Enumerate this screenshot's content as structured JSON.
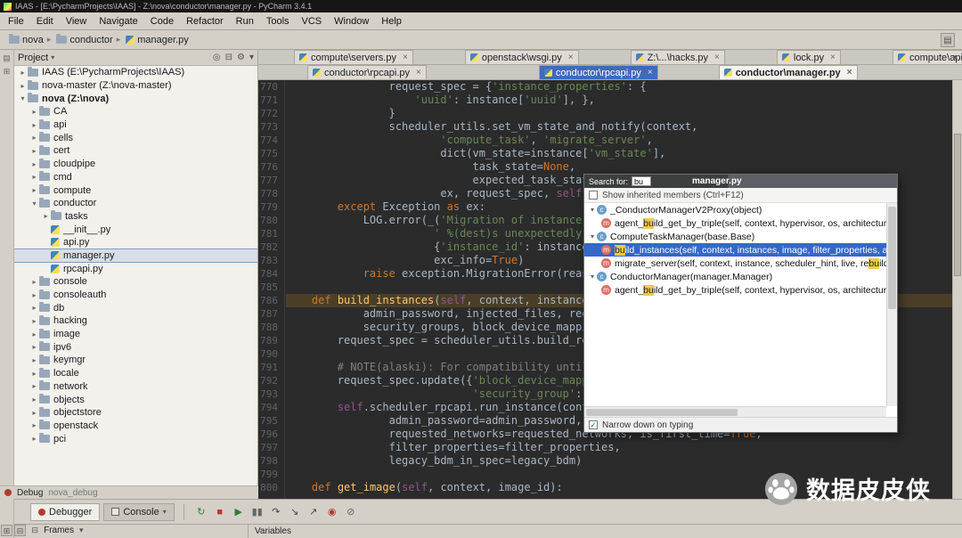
{
  "titlebar": {
    "title": "IAAS - [E:\\PycharmProjects\\IAAS] - Z:\\nova\\conductor\\manager.py - PyCharm 3.4.1"
  },
  "menubar": {
    "items": [
      "File",
      "Edit",
      "View",
      "Navigate",
      "Code",
      "Refactor",
      "Run",
      "Tools",
      "VCS",
      "Window",
      "Help"
    ]
  },
  "breadcrumb": {
    "items": [
      "nova",
      "conductor",
      "manager.py"
    ]
  },
  "icons": {
    "chevron_down": "▾",
    "close": "×",
    "gear": "⚙",
    "collapse_all": "⊟",
    "locate": "◎",
    "check": "✓",
    "grid": "▤",
    "square_plus": "⊞",
    "square_minus": "⊟"
  },
  "colors": {
    "editor_bg": "#2b2b2b",
    "keyword": "#cc7832",
    "string": "#6a8759",
    "comment": "#808080",
    "selection_blue": "#3c6cbb",
    "popup_selection": "#3468c9",
    "match_highlight": "#efc94c",
    "line_highlight": "#4a3f26"
  },
  "project_panel": {
    "title": "Project",
    "header_icons": [
      {
        "name": "locate-icon",
        "glyph": "◎"
      },
      {
        "name": "collapse-all-icon",
        "glyph": "⊟"
      },
      {
        "name": "settings-icon",
        "glyph": "⚙"
      },
      {
        "name": "hide-icon",
        "glyph": "▾"
      }
    ],
    "tree": [
      {
        "label": "IAAS (E:\\PycharmProjects\\IAAS)",
        "depth": 0,
        "kind": "folder",
        "arrow": "collapsed"
      },
      {
        "label": "nova-master (Z:\\nova-master)",
        "depth": 0,
        "kind": "folder",
        "arrow": "collapsed"
      },
      {
        "label": "nova (Z:\\nova)",
        "depth": 0,
        "kind": "folder",
        "arrow": "expanded",
        "bold": true
      },
      {
        "label": "CA",
        "depth": 1,
        "kind": "folder",
        "arrow": "collapsed"
      },
      {
        "label": "api",
        "depth": 1,
        "kind": "folder",
        "arrow": "collapsed"
      },
      {
        "label": "cells",
        "depth": 1,
        "kind": "folder",
        "arrow": "collapsed"
      },
      {
        "label": "cert",
        "depth": 1,
        "kind": "folder",
        "arrow": "collapsed"
      },
      {
        "label": "cloudpipe",
        "depth": 1,
        "kind": "folder",
        "arrow": "collapsed"
      },
      {
        "label": "cmd",
        "depth": 1,
        "kind": "folder",
        "arrow": "collapsed"
      },
      {
        "label": "compute",
        "depth": 1,
        "kind": "folder",
        "arrow": "collapsed"
      },
      {
        "label": "conductor",
        "depth": 1,
        "kind": "folder",
        "arrow": "expanded"
      },
      {
        "label": "tasks",
        "depth": 2,
        "kind": "folder",
        "arrow": "collapsed"
      },
      {
        "label": "__init__.py",
        "depth": 2,
        "kind": "pyfile"
      },
      {
        "label": "api.py",
        "depth": 2,
        "kind": "pyfile"
      },
      {
        "label": "manager.py",
        "depth": 2,
        "kind": "pyfile",
        "selected": true
      },
      {
        "label": "rpcapi.py",
        "depth": 2,
        "kind": "pyfile"
      },
      {
        "label": "console",
        "depth": 1,
        "kind": "folder",
        "arrow": "collapsed"
      },
      {
        "label": "consoleauth",
        "depth": 1,
        "kind": "folder",
        "arrow": "collapsed"
      },
      {
        "label": "db",
        "depth": 1,
        "kind": "folder",
        "arrow": "collapsed"
      },
      {
        "label": "hacking",
        "depth": 1,
        "kind": "folder",
        "arrow": "collapsed"
      },
      {
        "label": "image",
        "depth": 1,
        "kind": "folder",
        "arrow": "collapsed"
      },
      {
        "label": "ipv6",
        "depth": 1,
        "kind": "folder",
        "arrow": "collapsed"
      },
      {
        "label": "keymgr",
        "depth": 1,
        "kind": "folder",
        "arrow": "collapsed"
      },
      {
        "label": "locale",
        "depth": 1,
        "kind": "folder",
        "arrow": "collapsed"
      },
      {
        "label": "network",
        "depth": 1,
        "kind": "folder",
        "arrow": "collapsed"
      },
      {
        "label": "objects",
        "depth": 1,
        "kind": "folder",
        "arrow": "collapsed"
      },
      {
        "label": "objectstore",
        "depth": 1,
        "kind": "folder",
        "arrow": "collapsed"
      },
      {
        "label": "openstack",
        "depth": 1,
        "kind": "folder",
        "arrow": "collapsed"
      },
      {
        "label": "pci",
        "depth": 1,
        "kind": "folder",
        "arrow": "collapsed"
      }
    ]
  },
  "tabs": {
    "row1": [
      {
        "label": "compute\\servers.py"
      },
      {
        "label": "openstack\\wsgi.py"
      },
      {
        "label": "Z:\\...\\hacks.py"
      },
      {
        "label": "lock.py"
      },
      {
        "label": "compute\\api.py"
      }
    ],
    "row2": [
      {
        "label": "conductor\\rpcapi.py"
      },
      {
        "label": "conductor\\rpcapi.py",
        "state": "selected-blue"
      },
      {
        "label": "conductor\\manager.py",
        "state": "active"
      }
    ]
  },
  "editor": {
    "highlight_line": 786,
    "lines": [
      {
        "no": 770,
        "seg": [
          [
            "plain",
            "                request_spec = {"
          ],
          [
            "str",
            "'instance_properties'"
          ],
          [
            "plain",
            ": {"
          ]
        ]
      },
      {
        "no": 771,
        "seg": [
          [
            "plain",
            "                    "
          ],
          [
            "str",
            "'uuid'"
          ],
          [
            "plain",
            ": instance["
          ],
          [
            "str",
            "'uuid'"
          ],
          [
            "plain",
            "], },"
          ]
        ]
      },
      {
        "no": 772,
        "seg": [
          [
            "plain",
            "                }"
          ]
        ]
      },
      {
        "no": 773,
        "seg": [
          [
            "plain",
            "                scheduler_utils.set_vm_state_and_notify(context,"
          ]
        ]
      },
      {
        "no": 774,
        "seg": [
          [
            "plain",
            "                        "
          ],
          [
            "str",
            "'compute_task'"
          ],
          [
            "plain",
            ", "
          ],
          [
            "str",
            "'migrate_server'"
          ],
          [
            "plain",
            ","
          ]
        ]
      },
      {
        "no": 775,
        "seg": [
          [
            "plain",
            "                        dict(vm_state=instance["
          ],
          [
            "str",
            "'vm_state'"
          ],
          [
            "plain",
            "],"
          ]
        ]
      },
      {
        "no": 776,
        "seg": [
          [
            "plain",
            "                             task_state="
          ],
          [
            "kw",
            "None"
          ],
          [
            "plain",
            ","
          ]
        ]
      },
      {
        "no": 777,
        "seg": [
          [
            "plain",
            "                             expected_task_state=task_states.MIGRATING,),"
          ]
        ]
      },
      {
        "no": 778,
        "seg": [
          [
            "plain",
            "                        ex, request_spec, "
          ],
          [
            "self",
            "self"
          ],
          [
            "plain",
            ".db)"
          ]
        ]
      },
      {
        "no": 779,
        "seg": [
          [
            "plain",
            "        "
          ],
          [
            "kw",
            "except"
          ],
          [
            "plain",
            " Exception "
          ],
          [
            "kw",
            "as"
          ],
          [
            "plain",
            " ex:"
          ]
        ]
      },
      {
        "no": 780,
        "seg": [
          [
            "plain",
            "            LOG.error(_("
          ],
          [
            "str",
            "'Migration of instance %(instance_id)s to host'"
          ]
        ]
      },
      {
        "no": 781,
        "seg": [
          [
            "plain",
            "                       "
          ],
          [
            "str",
            "' %(dest)s unexpectedly failed.'"
          ],
          [
            "plain",
            "),"
          ]
        ]
      },
      {
        "no": 782,
        "seg": [
          [
            "plain",
            "                       {"
          ],
          [
            "str",
            "'instance_id'"
          ],
          [
            "plain",
            ": instance["
          ],
          [
            "str",
            "'uuid'"
          ],
          [
            "plain",
            "], "
          ],
          [
            "str",
            "'dest'"
          ],
          [
            "plain",
            ": destination},"
          ]
        ]
      },
      {
        "no": 783,
        "seg": [
          [
            "plain",
            "                       exc_info="
          ],
          [
            "kw",
            "True"
          ],
          [
            "plain",
            ")"
          ]
        ]
      },
      {
        "no": 784,
        "seg": [
          [
            "plain",
            "            "
          ],
          [
            "kw",
            "raise"
          ],
          [
            "plain",
            " exception.MigrationError(reason=ex)"
          ]
        ]
      },
      {
        "no": 785,
        "seg": []
      },
      {
        "no": 786,
        "seg": [
          [
            "plain",
            "    "
          ],
          [
            "kw",
            "def"
          ],
          [
            "plain",
            " "
          ],
          [
            "fn",
            "build_instances"
          ],
          [
            "plain",
            "("
          ],
          [
            "self",
            "self"
          ],
          [
            "plain",
            ", context, instances, image, filter_properties,"
          ]
        ]
      },
      {
        "no": 787,
        "seg": [
          [
            "plain",
            "            admin_password, injected_files, requested_networks,"
          ]
        ]
      },
      {
        "no": 788,
        "seg": [
          [
            "plain",
            "            security_groups, block_device_mapping, legacy_bdm="
          ],
          [
            "kw",
            "True"
          ],
          [
            "plain",
            "):"
          ]
        ]
      },
      {
        "no": 789,
        "seg": [
          [
            "plain",
            "        request_spec = scheduler_utils.build_request_spec(image, instances)"
          ]
        ]
      },
      {
        "no": 790,
        "seg": []
      },
      {
        "no": 791,
        "seg": [
          [
            "cmt",
            "        # NOTE(alaski): For compatibility until a new scheduler method is used."
          ]
        ]
      },
      {
        "no": 792,
        "seg": [
          [
            "plain",
            "        request_spec.update({"
          ],
          [
            "str",
            "'block_device_mapping'"
          ],
          [
            "plain",
            ": block_device_mapping,"
          ]
        ]
      },
      {
        "no": 793,
        "seg": [
          [
            "plain",
            "                             "
          ],
          [
            "str",
            "'security_group'"
          ],
          [
            "plain",
            ": security_groups})"
          ]
        ]
      },
      {
        "no": 794,
        "seg": [
          [
            "plain",
            "        "
          ],
          [
            "self",
            "self"
          ],
          [
            "plain",
            ".scheduler_rpcapi.run_instance(context, request_spec=request_spec,"
          ]
        ]
      },
      {
        "no": 795,
        "seg": [
          [
            "plain",
            "                admin_password=admin_password, injected_files=injected_files,"
          ]
        ]
      },
      {
        "no": 796,
        "seg": [
          [
            "plain",
            "                requested_networks=requested_networks, is_first_time="
          ],
          [
            "kw",
            "True"
          ],
          [
            "plain",
            ","
          ]
        ]
      },
      {
        "no": 797,
        "seg": [
          [
            "plain",
            "                filter_properties=filter_properties,"
          ]
        ]
      },
      {
        "no": 798,
        "seg": [
          [
            "plain",
            "                legacy_bdm_in_spec=legacy_bdm)"
          ]
        ]
      },
      {
        "no": 799,
        "seg": []
      },
      {
        "no": 800,
        "seg": [
          [
            "plain",
            "    "
          ],
          [
            "kw",
            "def"
          ],
          [
            "plain",
            " "
          ],
          [
            "fn",
            "get_image"
          ],
          [
            "plain",
            "("
          ],
          [
            "self",
            "self"
          ],
          [
            "plain",
            ", context, image_id):"
          ]
        ]
      }
    ]
  },
  "popup": {
    "search_label": "Search for:",
    "search_value": "bu",
    "title": "manager.py",
    "inherited_label": "Show inherited members (Ctrl+F12)",
    "narrow_label": "Narrow down on typing",
    "tree": [
      {
        "kind": "class",
        "depth": 0,
        "seg": [
          [
            "plain",
            "_ConductorManagerV2Proxy(object)"
          ]
        ]
      },
      {
        "kind": "method",
        "depth": 1,
        "seg": [
          [
            "plain",
            "agent_"
          ],
          [
            "match",
            "bu"
          ],
          [
            "plain",
            "ild_get_by_triple(self, context, hypervisor, os, architecture)"
          ]
        ]
      },
      {
        "kind": "class",
        "depth": 0,
        "seg": [
          [
            "plain",
            "ComputeTaskManager(base.Base)"
          ]
        ]
      },
      {
        "kind": "method",
        "depth": 1,
        "selected": true,
        "seg": [
          [
            "match",
            "bu"
          ],
          [
            "plain",
            "ild_instances(self, context, instances, image, filter_properties, admin"
          ]
        ]
      },
      {
        "kind": "method",
        "depth": 1,
        "seg": [
          [
            "plain",
            "migrate_server(self, context, instance, scheduler_hint, live, re"
          ],
          [
            "match",
            "bu"
          ],
          [
            "plain",
            "ild, flav"
          ]
        ]
      },
      {
        "kind": "class",
        "depth": 0,
        "seg": [
          [
            "plain",
            "ConductorManager(manager.Manager)"
          ]
        ]
      },
      {
        "kind": "method",
        "depth": 1,
        "seg": [
          [
            "plain",
            "agent_"
          ],
          [
            "match",
            "bu"
          ],
          [
            "plain",
            "ild_get_by_triple(self, context, hypervisor, os, architecture)"
          ]
        ]
      }
    ]
  },
  "bottom": {
    "debug_stripe_label": "Debug",
    "debug_config": "nova_debug",
    "tabs": [
      "Debugger",
      "Console"
    ],
    "toolbar_icons": [
      {
        "name": "rerun-icon",
        "glyph": "↻",
        "color": "#2e7d32"
      },
      {
        "name": "stop-icon",
        "glyph": "■",
        "color": "#b23b2e"
      },
      {
        "name": "resume-icon",
        "glyph": "▶",
        "color": "#2e7d32"
      },
      {
        "name": "pause-icon",
        "glyph": "▮▮",
        "color": "#666666"
      },
      {
        "name": "step-over-icon",
        "glyph": "↷",
        "color": "#444444"
      },
      {
        "name": "step-into-icon",
        "glyph": "↘",
        "color": "#444444"
      },
      {
        "name": "step-out-icon",
        "glyph": "↗",
        "color": "#444444"
      },
      {
        "name": "view-breakpoints-icon",
        "glyph": "◉",
        "color": "#b23b2e"
      },
      {
        "name": "mute-breakpoints-icon",
        "glyph": "⊘",
        "color": "#666666"
      }
    ],
    "frames_label": "Frames",
    "variables_label": "Variables"
  },
  "watermark": {
    "text": "数据皮皮侠"
  }
}
